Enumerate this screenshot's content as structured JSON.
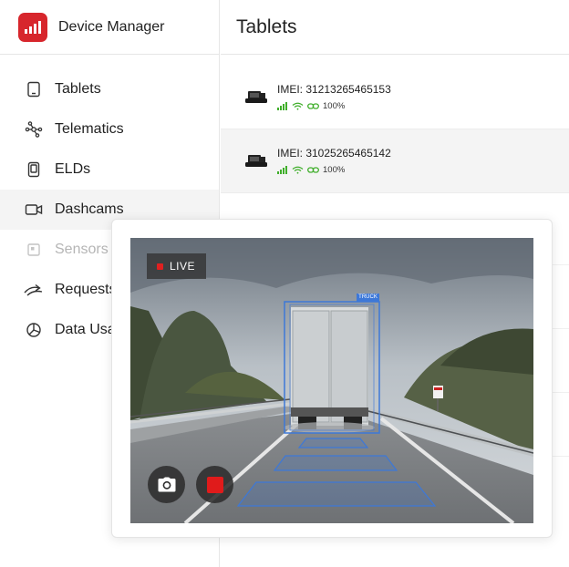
{
  "app": {
    "name": "Device Manager",
    "brand_color": "#d7262c",
    "logo_icon": "signal-bars-icon"
  },
  "sidebar": {
    "items": [
      {
        "label": "Tablets",
        "icon": "tablet-icon",
        "state": "normal"
      },
      {
        "label": "Telematics",
        "icon": "network-nodes-icon",
        "state": "normal"
      },
      {
        "label": "ELDs",
        "icon": "eld-device-icon",
        "state": "normal"
      },
      {
        "label": "Dashcams",
        "icon": "video-camera-icon",
        "state": "active"
      },
      {
        "label": "Sensors",
        "icon": "sensor-icon",
        "state": "disabled"
      },
      {
        "label": "Requests",
        "icon": "double-arrow-icon",
        "state": "normal"
      },
      {
        "label": "Data Usa",
        "icon": "pie-chart-icon",
        "state": "normal"
      }
    ]
  },
  "main": {
    "title": "Tablets",
    "devices": [
      {
        "imei": "IMEI: 31213265465153",
        "battery": "100%",
        "icon": "tablet-mount-icon"
      },
      {
        "imei": "IMEI: 31025265465142",
        "battery": "100%",
        "icon": "tablet-mount-icon"
      }
    ],
    "status_colors": {
      "signal": "#3fae2a",
      "wifi": "#3fae2a",
      "battery": "#3fae2a"
    }
  },
  "dashcam_modal": {
    "live_label": "LIVE",
    "detection_label": "TRUCK",
    "detection_color": "#3d78d8",
    "controls": [
      {
        "name": "snapshot",
        "icon": "camera-icon"
      },
      {
        "name": "record",
        "icon": "record-stop-icon"
      }
    ]
  }
}
